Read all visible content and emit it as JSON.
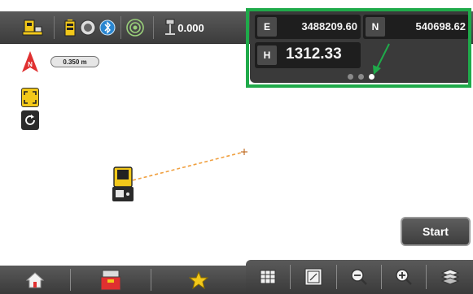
{
  "status_bar": {
    "height_value": "0.000",
    "icons": [
      "instrument-settings-icon",
      "battery-icon",
      "target-prism-icon",
      "bluetooth-icon",
      "radio-link-icon",
      "prism-height-icon",
      "tripod-icon"
    ]
  },
  "coordinates": {
    "e_tag": "E",
    "e_value": "3488209.60",
    "n_tag": "N",
    "n_value": "540698.62",
    "h_tag": "H",
    "h_value": "1312.33",
    "page_count": 3,
    "active_page": 3
  },
  "map": {
    "north_label": "N",
    "scale_label": "0.350 m",
    "accent_color": "#f2c81a",
    "line_color": "#f0a040"
  },
  "start_button": {
    "label": "Start"
  },
  "bottom_bar": {
    "left_icons": [
      "home-icon",
      "job-icon",
      "favorite-star-icon"
    ],
    "right_icons": [
      "grid-view-icon",
      "data-view-icon",
      "zoom-out-icon",
      "zoom-in-icon",
      "layers-icon"
    ]
  },
  "highlight_color": "#1faa4a"
}
